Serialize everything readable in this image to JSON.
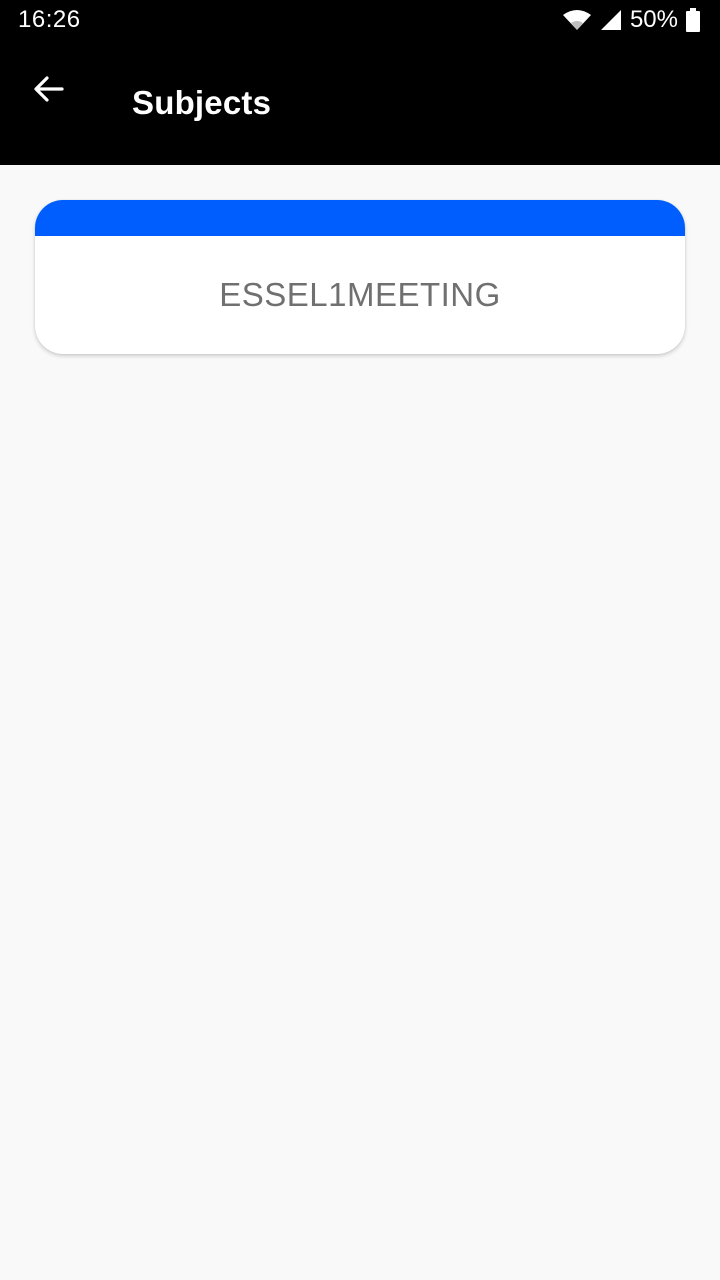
{
  "status_bar": {
    "time": "16:26",
    "battery": "50%",
    "icons": [
      "wifi-icon",
      "cellular-signal-icon",
      "battery-icon"
    ]
  },
  "app_bar": {
    "back_icon": "arrow-left-icon",
    "title": "Subjects"
  },
  "subjects": [
    {
      "label": "ESSEL1MEETING"
    }
  ],
  "colors": {
    "app_bar_background": "#000000",
    "card_accent": "#005eff",
    "page_background": "#f9f9f9",
    "card_text": "#707070"
  }
}
